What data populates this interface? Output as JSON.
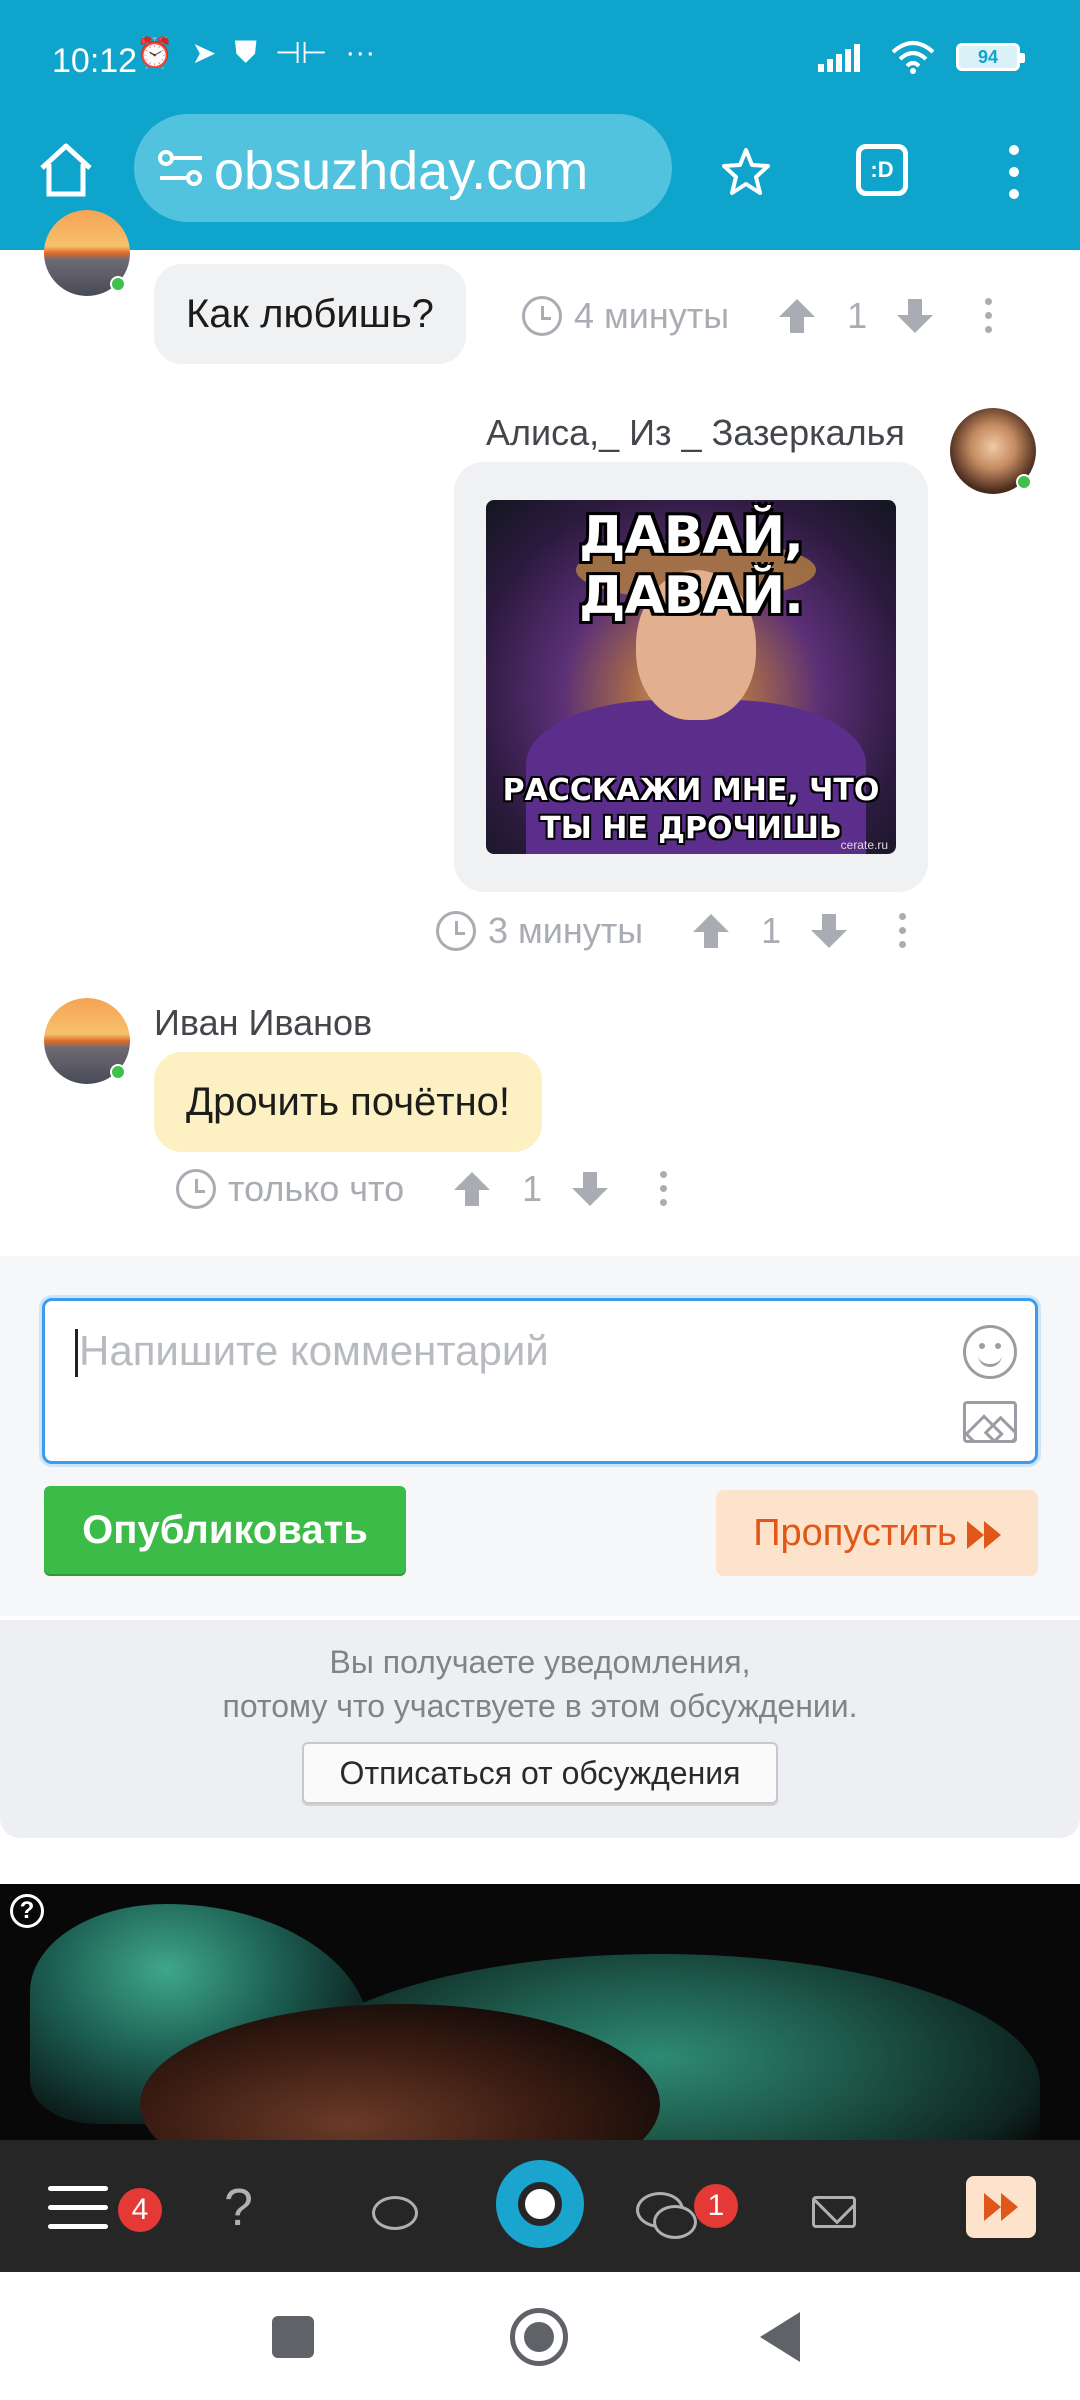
{
  "status_bar": {
    "time": "10:12",
    "battery": "94",
    "more": "···"
  },
  "browser": {
    "url": "obsuzhday.com",
    "tabs_label": ":D"
  },
  "comments": [
    {
      "author": "",
      "text": "Как любишь?",
      "time": "4 минуты",
      "votes": "1"
    },
    {
      "author": "Алиса,_ Из _ Зазеркалья",
      "meme_top": "ДАВАЙ, ДАВАЙ.",
      "meme_bottom_1": "РАССКАЖИ МНЕ, ЧТО",
      "meme_bottom_2": "ТЫ НЕ ДРОЧИШЬ",
      "meme_watermark": "сеrate.ru",
      "time": "3 минуты",
      "votes": "1"
    },
    {
      "author": "Иван Иванов",
      "text": "Дрочить почётно!",
      "time": "только что",
      "votes": "1"
    }
  ],
  "form": {
    "placeholder": "Напишите комментарий",
    "publish_label": "Опубликовать",
    "skip_label": "Пропустить"
  },
  "notice": {
    "line1": "Вы получаете уведомления,",
    "line2": "потому что участвуете в этом обсуждении.",
    "unsubscribe_label": "Отписаться от обсуждения"
  },
  "video_ad": {
    "help_mark": "?"
  },
  "app_bar": {
    "menu_badge": "4",
    "help_glyph": "?",
    "chats_badge": "1"
  },
  "colors": {
    "brand": "#0ea4cc",
    "publish": "#3dbb48",
    "skip_bg": "#fde3cb",
    "skip_text": "#e1571a",
    "badge": "#e53935"
  }
}
